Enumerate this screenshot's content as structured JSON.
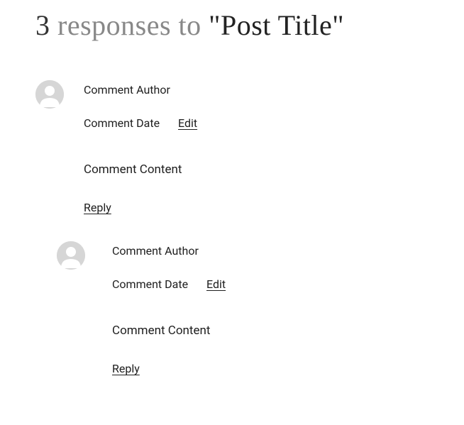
{
  "header": {
    "count": "3",
    "responses_text": "responses to",
    "post_title": "Post Title"
  },
  "comments": [
    {
      "author": "Comment Author",
      "date": "Comment Date",
      "edit": "Edit",
      "content": "Comment Content",
      "reply": "Reply"
    },
    {
      "author": "Comment Author",
      "date": "Comment Date",
      "edit": "Edit",
      "content": "Comment Content",
      "reply": "Reply"
    }
  ]
}
